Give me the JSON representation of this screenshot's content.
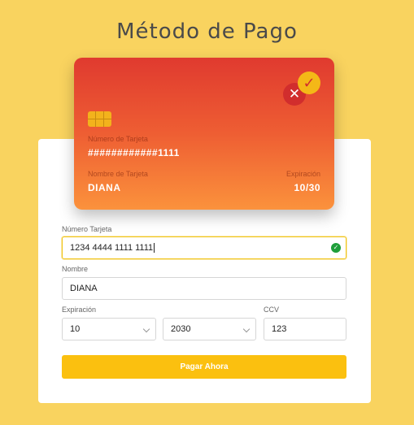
{
  "page": {
    "title": "Método de Pago"
  },
  "card": {
    "number_label": "Número de Tarjeta",
    "number_value": "############1111",
    "name_label": "Nombre de Tarjeta",
    "name_value": "DIANA",
    "expiry_label": "Expiración",
    "expiry_value": "10/30",
    "colors": {
      "top": "#e03a2f",
      "bottom": "#fb923c"
    }
  },
  "form": {
    "card_number": {
      "label": "Número Tarjeta",
      "value": "1234 4444 1111 1111"
    },
    "name": {
      "label": "Nombre",
      "value": "DIANA"
    },
    "expiry": {
      "label": "Expiración",
      "month": "10",
      "year": "2030"
    },
    "ccv": {
      "label": "CCV",
      "value": "123"
    },
    "submit_label": "Pagar Ahora"
  },
  "colors": {
    "background": "#f9d35f",
    "accent": "#fbc00f",
    "valid": "#1e9e3a"
  }
}
